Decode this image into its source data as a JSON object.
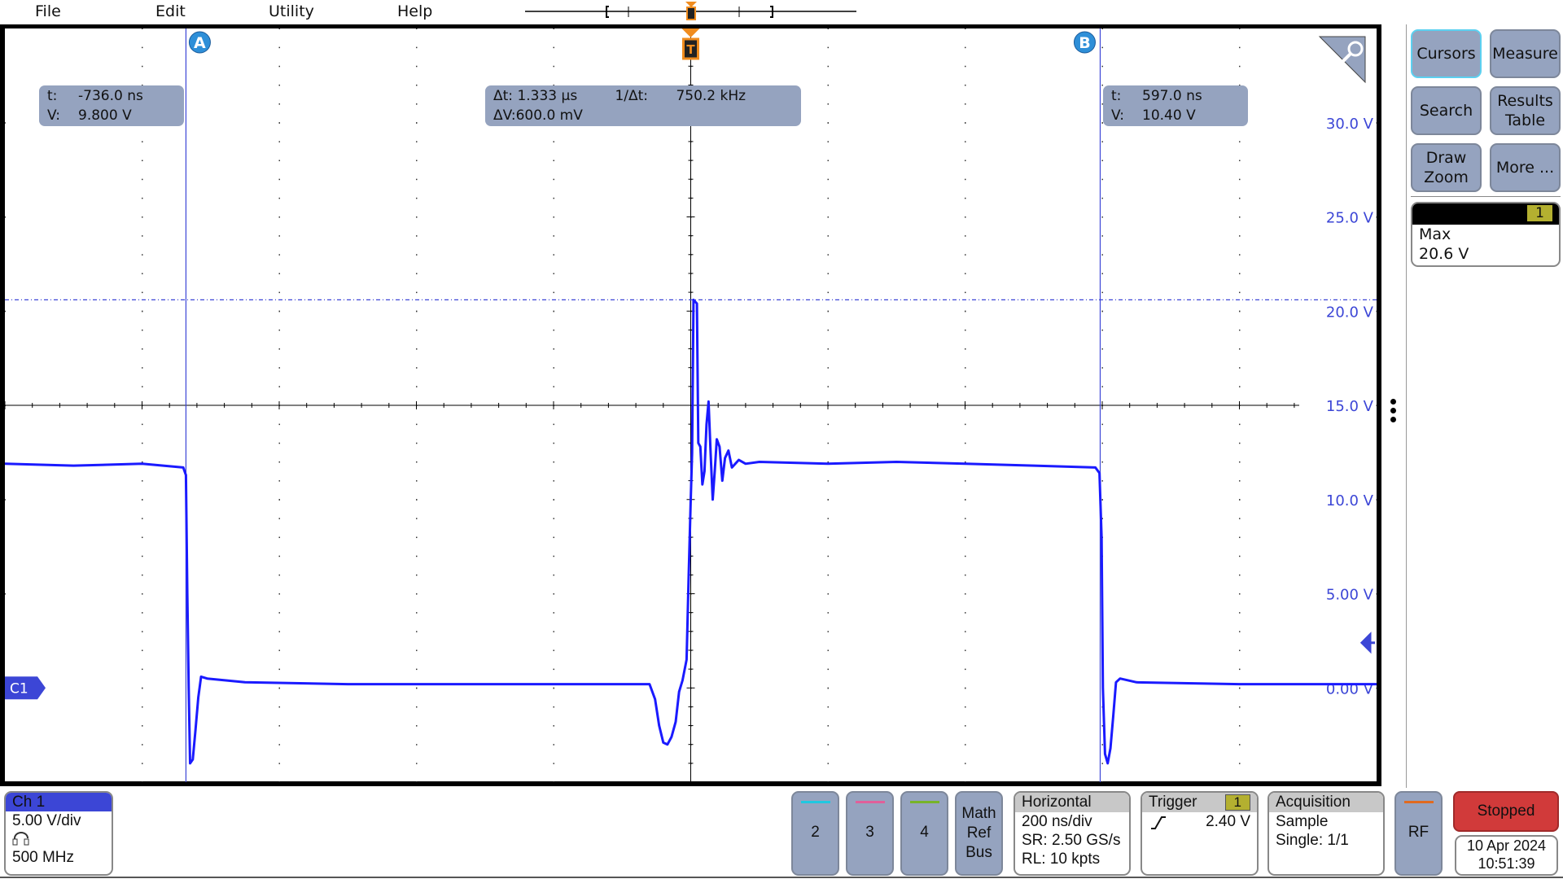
{
  "menu": {
    "items": [
      "File",
      "Edit",
      "Utility",
      "Help"
    ]
  },
  "colors": {
    "ch1": "#1a1aff",
    "accent": "#3c46d6",
    "trigger": "#f08c1e",
    "cursor_badge": "#2e8fd8",
    "readout_bg": "#95a3bf",
    "stopped": "#d13a3a",
    "ch2": "#20c8e0",
    "ch3": "#e0609a",
    "ch4": "#78b428",
    "rf": "#e06a20",
    "trigger_badge": "#b4b030"
  },
  "cursors": {
    "a": {
      "badge": "A",
      "t_label": "t:",
      "t_value": "-736.0 ns",
      "v_label": "V:",
      "v_value": "9.800 V"
    },
    "b": {
      "badge": "B",
      "t_label": "t:",
      "t_value": "597.0 ns",
      "v_label": "V:",
      "v_value": "10.40 V"
    },
    "delta": {
      "dt_label": "Δt:",
      "dt_value": "1.333 µs",
      "inv_label": "1/Δt:",
      "inv_value": "750.2 kHz",
      "dv_label": "ΔV:",
      "dv_value": "600.0 mV"
    }
  },
  "trigger_marker": "T",
  "channel_marker": "C1",
  "chart_data": {
    "type": "line",
    "xlim": [
      -1000,
      1000
    ],
    "x_unit": "ns",
    "ylim": [
      -5,
      35
    ],
    "grid": true,
    "y_tick_labels": [
      "30.0 V",
      "25.0 V",
      "20.0 V",
      "15.0 V",
      "10.0 V",
      "5.00 V",
      "0.00 V"
    ],
    "y_tick_values": [
      30,
      25,
      20,
      15,
      10,
      5,
      0
    ],
    "trigger_level": 2.4,
    "max_line": 20.6,
    "cursor_a_t": -736,
    "cursor_b_t": 597,
    "series": [
      {
        "points": [
          [
            -1000,
            11.9
          ],
          [
            -900,
            11.8
          ],
          [
            -800,
            11.9
          ],
          [
            -740,
            11.7
          ],
          [
            -736,
            11.3
          ],
          [
            -734,
            5
          ],
          [
            -732,
            0
          ],
          [
            -730,
            -4.0
          ],
          [
            -726,
            -3.8
          ],
          [
            -722,
            -2.2
          ],
          [
            -718,
            -0.5
          ],
          [
            -714,
            0.6
          ],
          [
            -705,
            0.5
          ],
          [
            -650,
            0.3
          ],
          [
            -500,
            0.2
          ],
          [
            -300,
            0.2
          ],
          [
            -100,
            0.2
          ],
          [
            -60,
            0.2
          ],
          [
            -52,
            -0.6
          ],
          [
            -46,
            -2.0
          ],
          [
            -40,
            -2.9
          ],
          [
            -34,
            -3.0
          ],
          [
            -28,
            -2.6
          ],
          [
            -22,
            -1.8
          ],
          [
            -17,
            -0.2
          ],
          [
            -12,
            0.4
          ],
          [
            -6,
            1.5
          ],
          [
            -3,
            6
          ],
          [
            0,
            10
          ],
          [
            2,
            12.5
          ],
          [
            4,
            20.6
          ],
          [
            9,
            20.4
          ],
          [
            11,
            13
          ],
          [
            14,
            12.8
          ],
          [
            17,
            10.8
          ],
          [
            20,
            11.5
          ],
          [
            23,
            14
          ],
          [
            26,
            15.2
          ],
          [
            29,
            12.5
          ],
          [
            32,
            10
          ],
          [
            35,
            11.5
          ],
          [
            38,
            13.2
          ],
          [
            42,
            12.8
          ],
          [
            46,
            11
          ],
          [
            50,
            12.2
          ],
          [
            55,
            12.6
          ],
          [
            60,
            11.7
          ],
          [
            70,
            12.1
          ],
          [
            80,
            11.9
          ],
          [
            100,
            12
          ],
          [
            200,
            11.9
          ],
          [
            300,
            12.0
          ],
          [
            400,
            11.9
          ],
          [
            500,
            11.8
          ],
          [
            590,
            11.7
          ],
          [
            596,
            11.4
          ],
          [
            599,
            8
          ],
          [
            601,
            0
          ],
          [
            604,
            -3.5
          ],
          [
            608,
            -4.0
          ],
          [
            612,
            -3.2
          ],
          [
            616,
            -1.5
          ],
          [
            620,
            0.3
          ],
          [
            626,
            0.5
          ],
          [
            650,
            0.3
          ],
          [
            800,
            0.2
          ],
          [
            1000,
            0.2
          ]
        ]
      }
    ]
  },
  "right_panel": {
    "buttons": [
      "Cursors",
      "Measure",
      "Search",
      "Results Table",
      "Draw Zoom",
      "More ..."
    ],
    "measurement": {
      "source": "1",
      "name": "Max",
      "value": "20.6 V"
    }
  },
  "bottom": {
    "ch1": {
      "title": "Ch 1",
      "scale": "5.00 V/div",
      "bandwidth": "500 MHz",
      "probe_icon": "probe-icon"
    },
    "channel_buttons": [
      "2",
      "3",
      "4"
    ],
    "math_ref_bus": [
      "Math",
      "Ref",
      "Bus"
    ],
    "horizontal": {
      "title": "Horizontal",
      "scale": "200 ns/div",
      "sr": "SR: 2.50 GS/s",
      "rl": "RL: 10 kpts"
    },
    "trigger": {
      "title": "Trigger",
      "source": "1",
      "slope_icon": "rising-edge-icon",
      "level": "2.40 V"
    },
    "acquisition": {
      "title": "Acquisition",
      "mode": "Sample",
      "count": "Single: 1/1"
    },
    "rf": "RF",
    "status": "Stopped",
    "date": "10 Apr 2024",
    "time": "10:51:39"
  }
}
